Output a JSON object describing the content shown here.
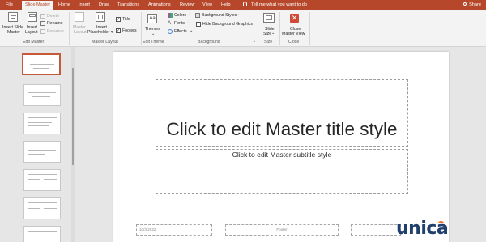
{
  "tabs": [
    "File",
    "Slide Master",
    "Home",
    "Insert",
    "Draw",
    "Transitions",
    "Animations",
    "Review",
    "View",
    "Help"
  ],
  "tell_me": "Tell me what you want to do",
  "share": "Share",
  "ribbon": {
    "edit_master": {
      "insert_slide_master": [
        "Insert Slide",
        "Master"
      ],
      "insert_layout": [
        "Insert",
        "Layout"
      ],
      "delete": "Delete",
      "rename": "Rename",
      "preserve": "Preserve",
      "label": "Edit Master"
    },
    "master_layout": {
      "master_layout": [
        "Master",
        "Layout"
      ],
      "insert_placeholder": [
        "Insert",
        "Placeholder ▾"
      ],
      "title": "Title",
      "footers": "Footers",
      "label": "Master Layout"
    },
    "edit_theme": {
      "themes": "Themes",
      "label": "Edit Theme"
    },
    "background": {
      "colors": "Colors",
      "fonts": "Fonts",
      "effects": "Effects",
      "background_styles": "Background Styles",
      "hide_bg_graphics": "Hide Background Graphics",
      "label": "Background"
    },
    "size": {
      "slide_size": [
        "Slide",
        "Size"
      ],
      "label": "Size"
    },
    "close": {
      "close_master_view": [
        "Close",
        "Master View"
      ],
      "label": "Close"
    }
  },
  "slide": {
    "title": "Click to edit Master title style",
    "subtitle": "Click to edit Master subtitle style",
    "date": "10/3/2022",
    "footer": "Footer"
  },
  "watermark": "unica",
  "colors": {
    "accent": "#b7472a",
    "close_icon": "#d04a37",
    "watermark": "#1f3f6e",
    "watermark_dot": "#e8732a"
  }
}
